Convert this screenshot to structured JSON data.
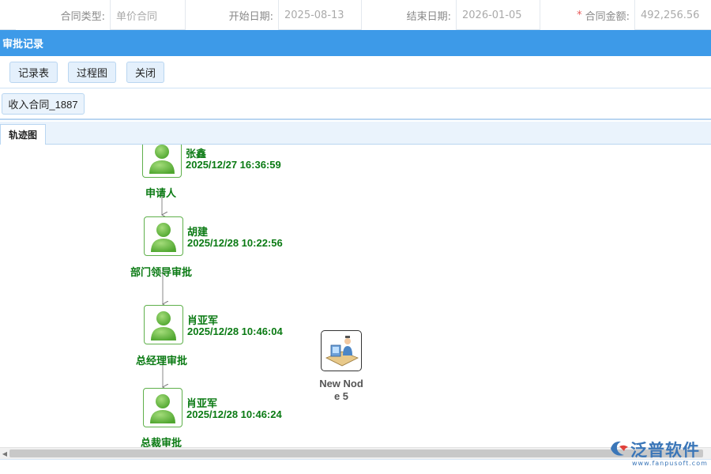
{
  "form": {
    "contract_type_label": "合同类型:",
    "contract_type_value": "单价合同",
    "start_date_label": "开始日期:",
    "start_date_value": "2025-08-13",
    "end_date_label": "结束日期:",
    "end_date_value": "2026-01-05",
    "amount_required_mark": "*",
    "amount_label": "合同金额:",
    "amount_value": "492,256.56"
  },
  "title": "审批记录",
  "toolbar": {
    "record_table_label": "记录表",
    "process_chart_label": "过程图",
    "close_label": "关闭"
  },
  "contract_tag": "收入合同_1887",
  "tabs": [
    {
      "label": "轨迹图"
    }
  ],
  "flow": {
    "nodes": [
      {
        "name": "张鑫",
        "time": "2025/12/27 16:36:59",
        "role": "申请人"
      },
      {
        "name": "胡建",
        "time": "2025/12/28 10:22:56",
        "role": "部门领导审批"
      },
      {
        "name": "肖亚军",
        "time": "2025/12/28 10:46:04",
        "role": "总经理审批"
      },
      {
        "name": "肖亚军",
        "time": "2025/12/28 10:46:24",
        "role": "总裁审批"
      }
    ],
    "new_node": {
      "label_line1": "New Nod",
      "label_line2": "e 5"
    }
  },
  "logo": {
    "name": "泛普软件",
    "url": "www.fanpusoft.com"
  },
  "colors": {
    "header_blue": "#3d9ae8",
    "node_green": "#0a7a13",
    "required_red": "#e85a5a"
  }
}
